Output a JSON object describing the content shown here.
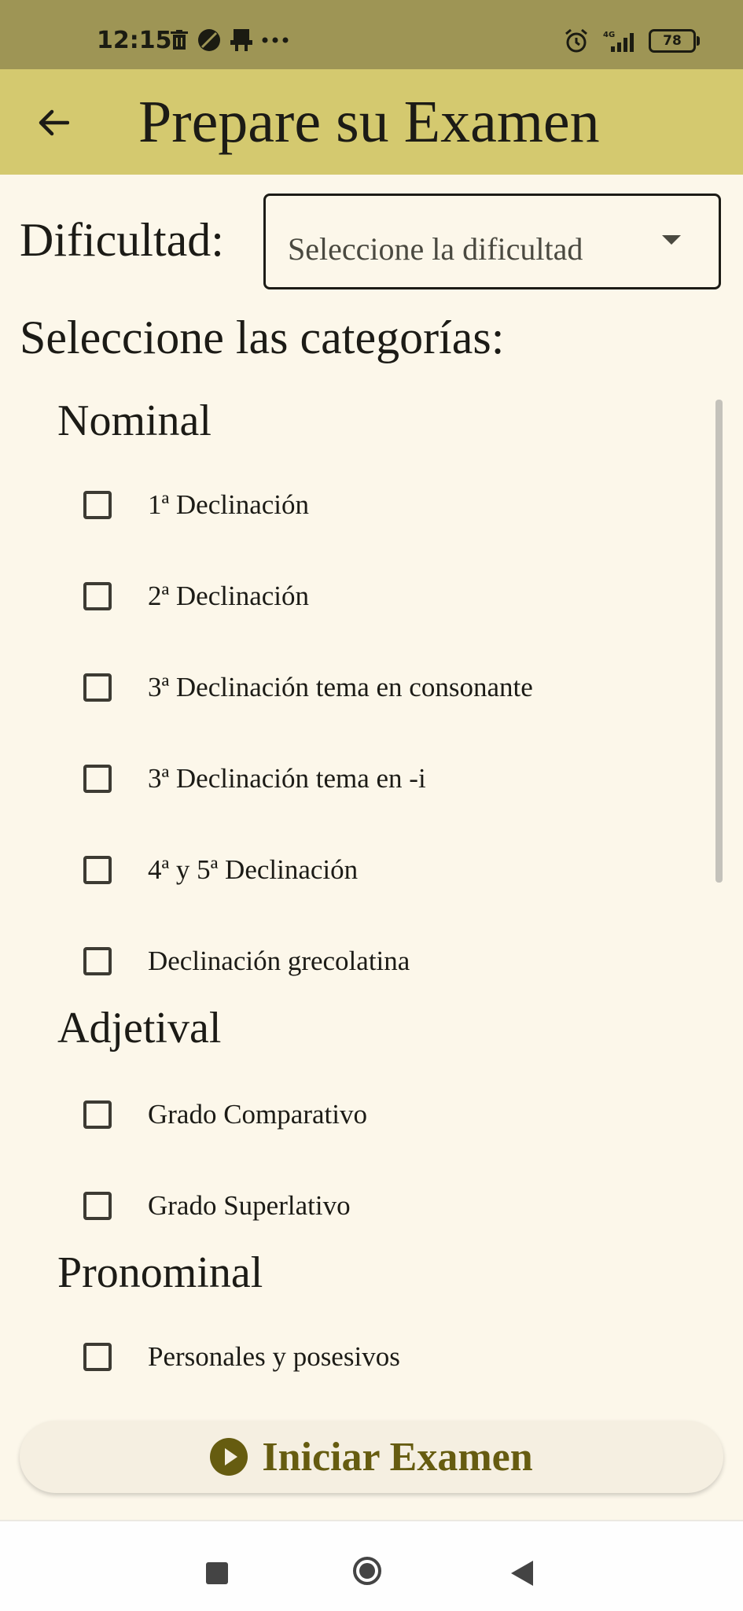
{
  "status_bar": {
    "time": "12:15",
    "left_icons": [
      "delete-icon",
      "leaf-icon",
      "printer-icon",
      "more-icon"
    ],
    "network": "4G",
    "battery": "78"
  },
  "app_bar": {
    "title": "Prepare su Examen",
    "back_icon": "arrow-back-icon"
  },
  "difficulty": {
    "label": "Dificultad:",
    "placeholder": "Seleccione la dificultad",
    "selected": ""
  },
  "categories_title": "Seleccione las categorías:",
  "groups": [
    {
      "title": "Nominal",
      "items": [
        {
          "label": "1ª Declinación",
          "checked": false
        },
        {
          "label": "2ª Declinación",
          "checked": false
        },
        {
          "label": "3ª Declinación tema en consonante",
          "checked": false
        },
        {
          "label": "3ª Declinación tema en -i",
          "checked": false
        },
        {
          "label": "4ª y 5ª Declinación",
          "checked": false
        },
        {
          "label": "Declinación grecolatina",
          "checked": false
        }
      ]
    },
    {
      "title": "Adjetival",
      "items": [
        {
          "label": "Grado Comparativo",
          "checked": false
        },
        {
          "label": "Grado Superlativo",
          "checked": false
        }
      ]
    },
    {
      "title": "Pronominal",
      "items": [
        {
          "label": "Personales y posesivos",
          "checked": false
        }
      ]
    }
  ],
  "start_button": {
    "label": "Iniciar Examen",
    "icon": "play-circle-icon"
  },
  "colors": {
    "status_bar": "#9e9555",
    "app_bar": "#d4c96f",
    "background": "#fcf7ea",
    "accent": "#665c10"
  }
}
